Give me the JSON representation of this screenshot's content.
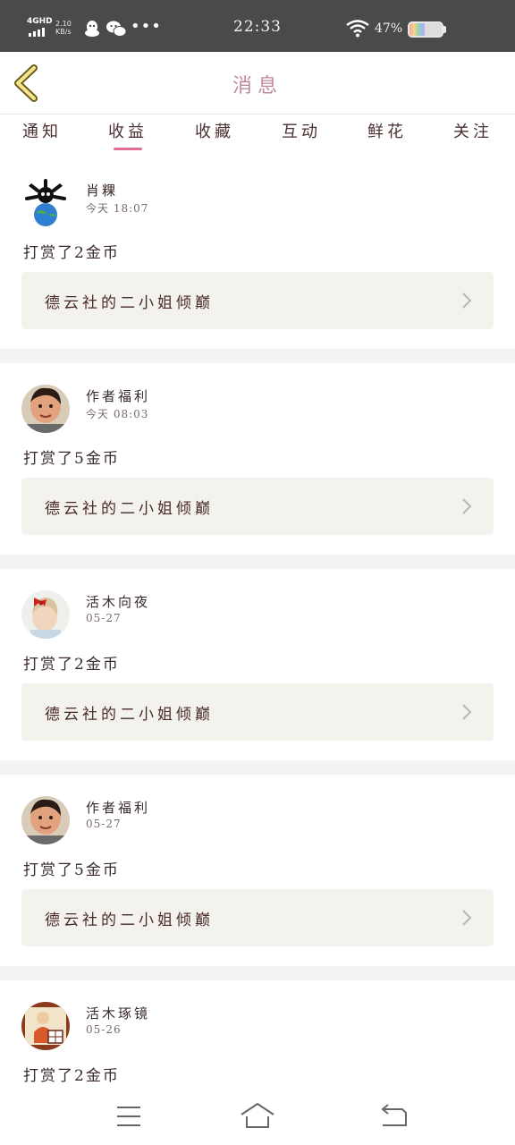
{
  "status_bar": {
    "network": "4GHD",
    "speed_value": "2.10",
    "speed_unit": "KB/s",
    "time": "22:33",
    "battery_percent": "47%",
    "battery_level": 0.47,
    "icons": [
      "signal-icon",
      "qq-icon",
      "wechat-icon",
      "more-dots-icon",
      "wifi-icon",
      "battery-icon"
    ]
  },
  "header": {
    "back_icon": "chevron-left-icon",
    "title": "消息"
  },
  "tabs": [
    {
      "label": "通知",
      "active": false
    },
    {
      "label": "收益",
      "active": true
    },
    {
      "label": "收藏",
      "active": false
    },
    {
      "label": "互动",
      "active": false
    },
    {
      "label": "鲜花",
      "active": false
    },
    {
      "label": "关注",
      "active": false
    }
  ],
  "messages": [
    {
      "user": "肖粿",
      "time": "今天 18:07",
      "text": "打赏了2金币",
      "book": "德云社的二小姐倾巅",
      "avatar": "cartoon-avatar"
    },
    {
      "user": "作者福利",
      "time": "今天 08:03",
      "text": "打赏了5金币",
      "book": "德云社的二小姐倾巅",
      "avatar": "child-photo-avatar"
    },
    {
      "user": "活木向夜",
      "time": "05-27",
      "text": "打赏了2金币",
      "book": "德云社的二小姐倾巅",
      "avatar": "girl-photo-avatar"
    },
    {
      "user": "作者福利",
      "time": "05-27",
      "text": "打赏了5金币",
      "book": "德云社的二小姐倾巅",
      "avatar": "child-photo-avatar"
    },
    {
      "user": "活木琢镜",
      "time": "05-26",
      "text": "打赏了2金币",
      "book": "",
      "avatar": "illustration-avatar"
    }
  ],
  "nav": {
    "icons": [
      "menu-icon",
      "home-icon",
      "back-arrow-icon"
    ]
  },
  "colors": {
    "accent": "#e06e95",
    "status_bar_bg": "#4a4a4a",
    "card_link_bg": "#f3f2ec",
    "separator": "#f3f3f3"
  }
}
